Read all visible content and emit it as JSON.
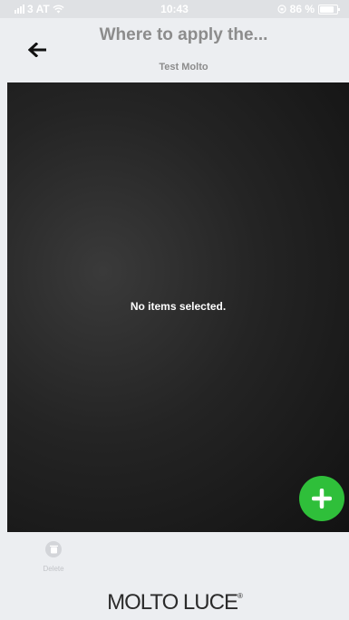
{
  "status_bar": {
    "carrier": "3 AT",
    "time": "10:43",
    "battery": "86 %"
  },
  "header": {
    "title": "Where to apply the...",
    "subtitle": "Test Molto"
  },
  "content": {
    "empty_message": "No items selected."
  },
  "bottom_bar": {
    "delete_label": "Delete"
  },
  "brand": {
    "logo_text": "MOLTO LUCE",
    "logo_mark": "®"
  },
  "colors": {
    "fab": "#2fbf3a",
    "title": "#8c8c8c"
  },
  "icons": {
    "back": "arrow-left-icon",
    "add": "plus-icon",
    "delete": "trash-icon"
  }
}
